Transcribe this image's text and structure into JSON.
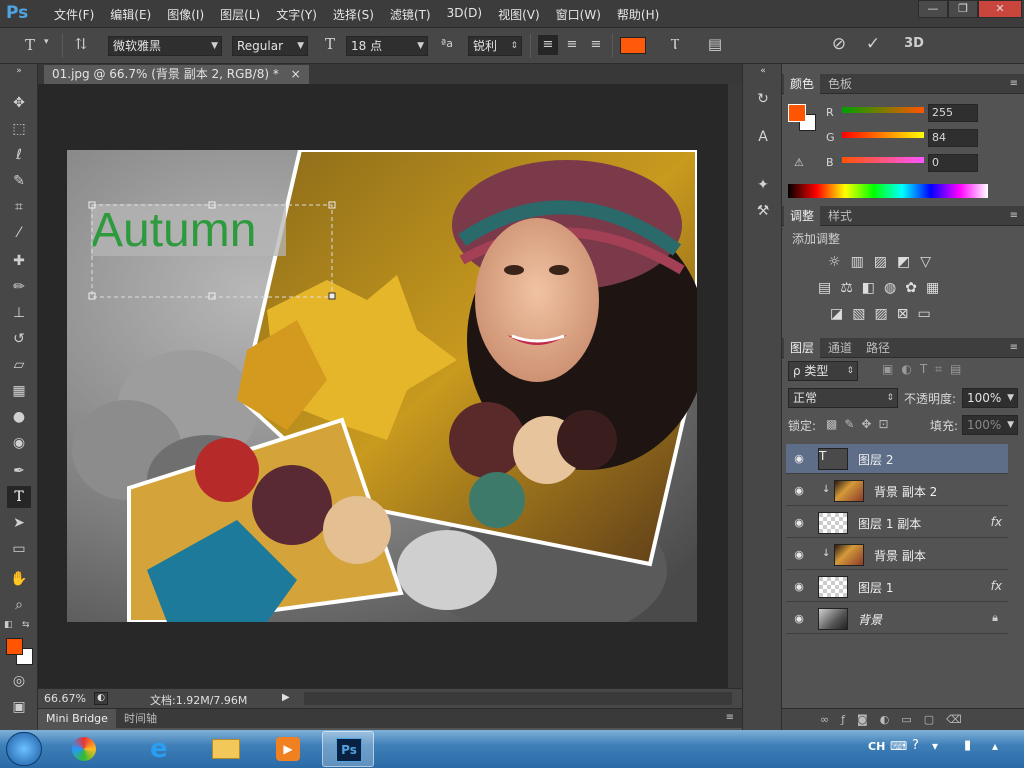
{
  "app": {
    "logo": "Ps"
  },
  "menu": [
    "文件(F)",
    "编辑(E)",
    "图像(I)",
    "图层(L)",
    "文字(Y)",
    "选择(S)",
    "滤镜(T)",
    "3D(D)",
    "视图(V)",
    "窗口(W)",
    "帮助(H)"
  ],
  "window_controls": {
    "minimize": "—",
    "restore": "❐",
    "close": "✕"
  },
  "options": {
    "font_family": "微软雅黑",
    "font_style": "Regular",
    "font_size": "18 点",
    "aa_label": "ªa",
    "antialias": "锐利",
    "text_color": "#ff5a0a",
    "confirm_3d": "3D"
  },
  "document": {
    "tab_title": "01.jpg @ 66.7% (背景 副本 2, RGB/8) *",
    "tab_close": "×",
    "canvas_text": "Autumn",
    "canvas_text_color": "#2e9a3e"
  },
  "status": {
    "zoom": "66.67%",
    "doc_info": "文档:1.92M/7.96M"
  },
  "bottom_tabs": [
    "Mini Bridge",
    "时间轴"
  ],
  "color_panel": {
    "tabs": [
      "颜色",
      "色板"
    ],
    "foreground": "#ff5400",
    "background": "#ffffff",
    "r_label": "R",
    "r_value": "255",
    "g_label": "G",
    "g_value": "84",
    "b_label": "B",
    "b_value": "0"
  },
  "adjust_panel": {
    "tabs": [
      "调整",
      "样式"
    ],
    "title": "添加调整"
  },
  "layers_panel": {
    "tabs": [
      "图层",
      "通道",
      "路径"
    ],
    "filter_label": "ρ 类型",
    "blend_mode": "正常",
    "opacity_label": "不透明度:",
    "opacity": "100%",
    "lock_label": "锁定:",
    "fill_label": "填充:",
    "fill": "100%",
    "layers": [
      {
        "name": "图层 2",
        "type": "text",
        "selected": true,
        "fx": false,
        "clip": false
      },
      {
        "name": "背景 副本 2",
        "type": "photo",
        "selected": false,
        "fx": false,
        "clip": true
      },
      {
        "name": "图层 1 副本",
        "type": "transparent",
        "selected": false,
        "fx": true,
        "clip": false
      },
      {
        "name": "背景 副本",
        "type": "photo",
        "selected": false,
        "fx": false,
        "clip": true
      },
      {
        "name": "图层 1",
        "type": "transparent",
        "selected": false,
        "fx": true,
        "clip": false
      },
      {
        "name": "背景",
        "type": "bg",
        "selected": false,
        "fx": false,
        "clip": false
      }
    ],
    "fx_label": "fx"
  },
  "taskbar": {
    "lang": "CH"
  }
}
